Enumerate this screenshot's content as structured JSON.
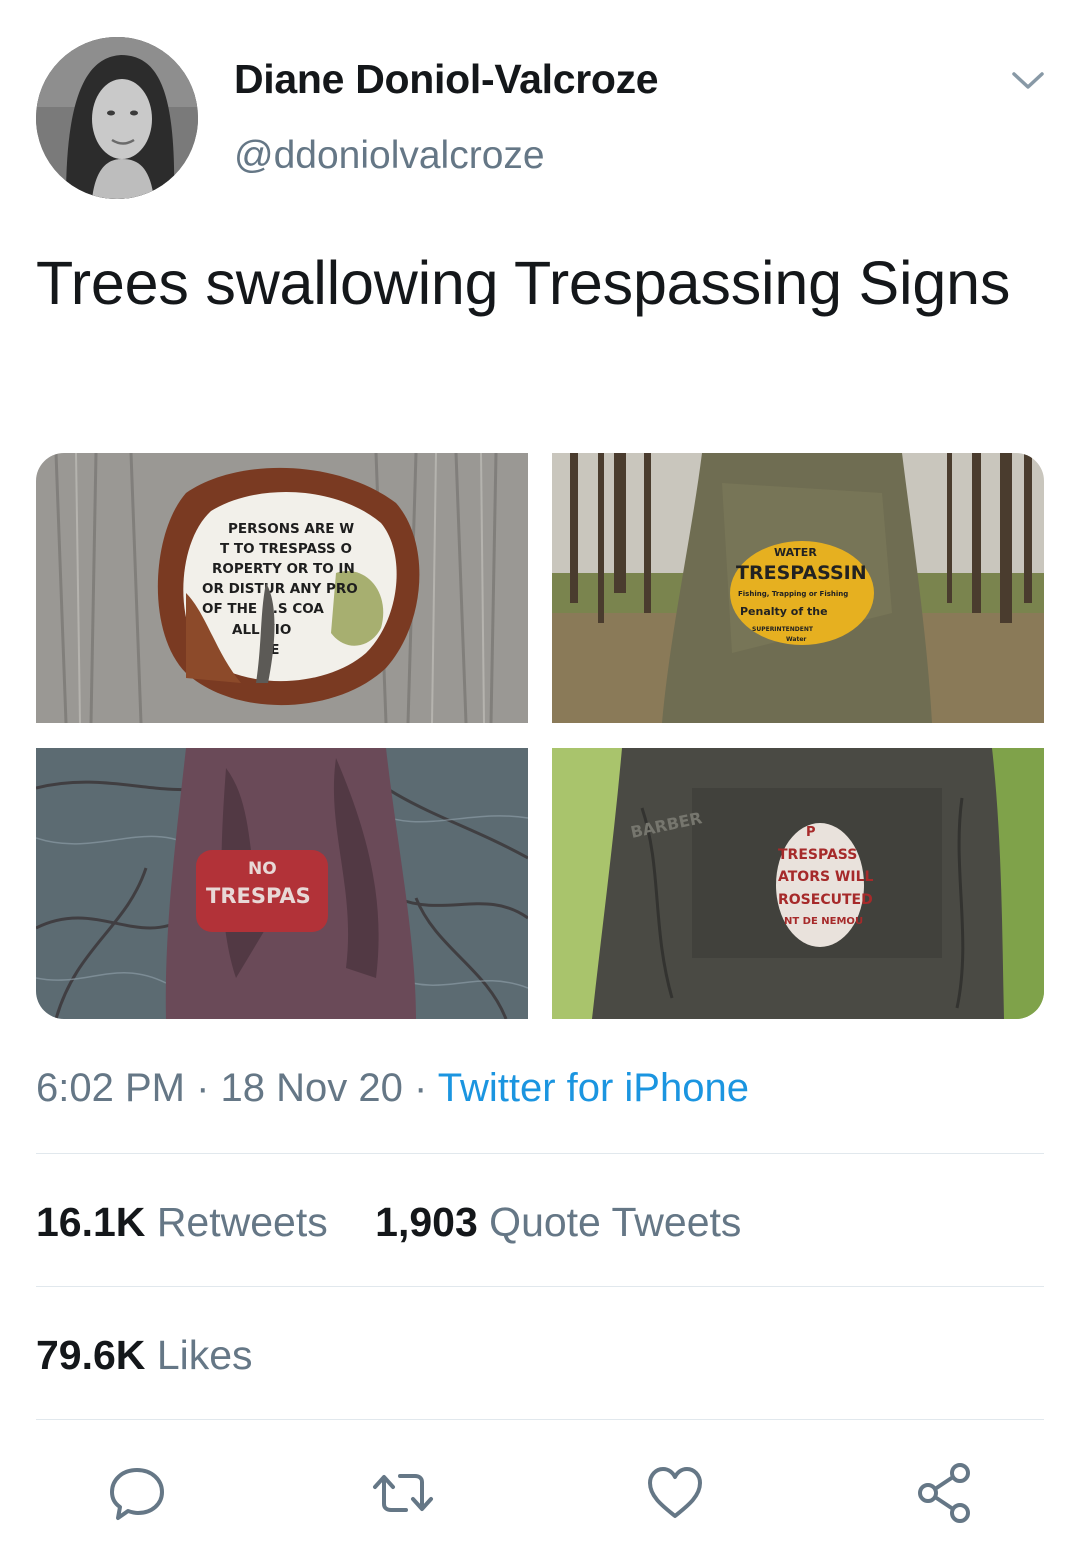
{
  "author": {
    "name": "Diane Doniol-Valcroze",
    "handle": "@ddoniolvalcroze"
  },
  "tweet": {
    "text": "Trees swallowing Trespassing Signs",
    "time": "6:02 PM",
    "date": "18 Nov 20",
    "source": "Twitter for iPhone"
  },
  "media": {
    "photo1_sign_lines": [
      "PERSONS ARE W",
      "T TO TRESPASS O",
      "ROPERTY OR TO IN",
      "OR DISTUR ANY PRO",
      "OF THE U.S COA",
      "ALL VIO",
      "BE"
    ],
    "photo2_sign_lines": [
      "WATER",
      "TRESPASSIN",
      "Fishing, Trapping or Fishing",
      "Penalty of the",
      "SUPERINTENDENT",
      "Water"
    ],
    "photo3_sign_lines": [
      "NO",
      "TRESPAS"
    ],
    "photo4_sign_lines": [
      "P",
      "TRESPASS",
      "ATORS WILL",
      "ROSECUTED",
      "NT DE NEMOU"
    ],
    "photo4_carving": "BARBER"
  },
  "stats": {
    "retweets_count": "16.1K",
    "retweets_label": "Retweets",
    "quotes_count": "1,903",
    "quotes_label": "Quote Tweets",
    "likes_count": "79.6K",
    "likes_label": "Likes"
  },
  "icons": {
    "reply": "speech-bubble-icon",
    "retweet": "retweet-arrows-icon",
    "like": "heart-outline-icon",
    "share": "share-nodes-icon",
    "menu": "chevron-down-icon"
  },
  "colors": {
    "text": "#14171a",
    "secondary": "#657786",
    "link": "#1b95e0",
    "divider": "#e1e8ed"
  }
}
